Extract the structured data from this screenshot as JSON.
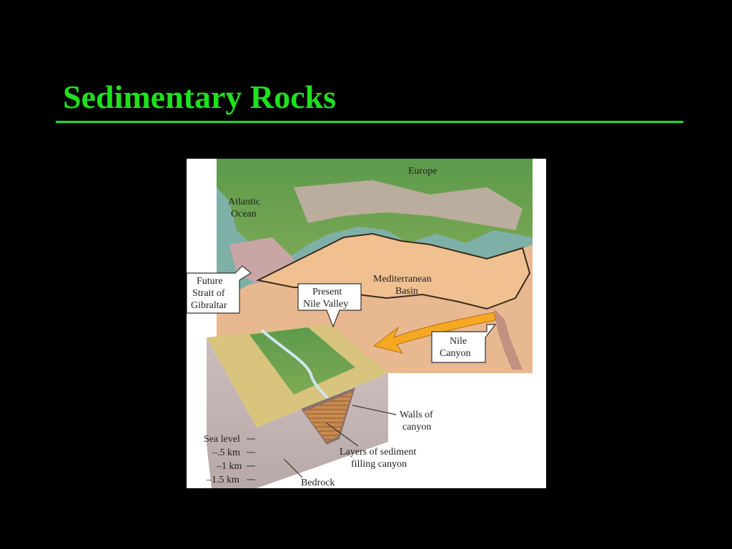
{
  "slide": {
    "title": "Sedimentary Rocks"
  },
  "figure": {
    "labels": {
      "europe": "Europe",
      "atlantic_1": "Atlantic",
      "atlantic_2": "Ocean",
      "gibraltar_1": "Future",
      "gibraltar_2": "Strait of",
      "gibraltar_3": "Gibraltar",
      "present_1": "Present",
      "present_2": "Nile Valley",
      "basin_1": "Mediterranean",
      "basin_2": "Basin",
      "canyon_1": "Nile",
      "canyon_2": "Canyon",
      "walls_1": "Walls of",
      "walls_2": "canyon",
      "layers_1": "Layers of sediment",
      "layers_2": "filling canyon",
      "bedrock": "Bedrock",
      "depth_0": "Sea level",
      "depth_1": "–.5 km",
      "depth_2": "–1 km",
      "depth_3": "–1.5 km"
    }
  }
}
